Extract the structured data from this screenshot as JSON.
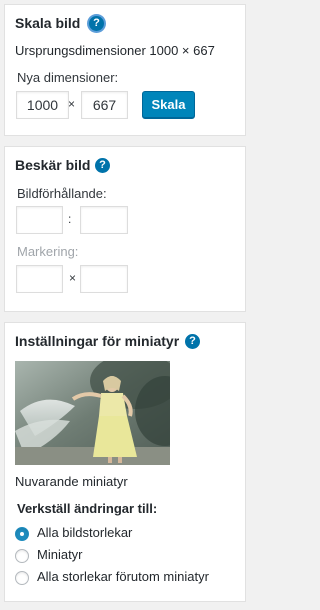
{
  "scale": {
    "title": "Skala bild",
    "help_icon": "?",
    "original_dimensions": "Ursprungsdimensioner 1000 × 667",
    "new_dimensions_label": "Nya dimensioner:",
    "width_value": "1000",
    "separator": "×",
    "height_value": "667",
    "scale_button": "Skala"
  },
  "crop": {
    "title": "Beskär bild",
    "help_icon": "?",
    "ratio_label": "Bildförhållande:",
    "ratio_separator": ":",
    "selection_label": "Markering:",
    "selection_separator": "×"
  },
  "thumbnail": {
    "title": "Inställningar för miniatyr",
    "help_icon": "?",
    "current_caption": "Nuvarande miniatyr",
    "apply_label": "Verkställ ändringar till:",
    "options": [
      {
        "label": "Alla bildstorlekar",
        "checked": true
      },
      {
        "label": "Miniatyr",
        "checked": false
      },
      {
        "label": "Alla storlekar förutom miniatyr",
        "checked": false
      }
    ]
  },
  "colors": {
    "accent": "#0073aa",
    "button": "#0085ba",
    "panel_bg": "#ffffff",
    "page_bg": "#f1f1f1"
  }
}
